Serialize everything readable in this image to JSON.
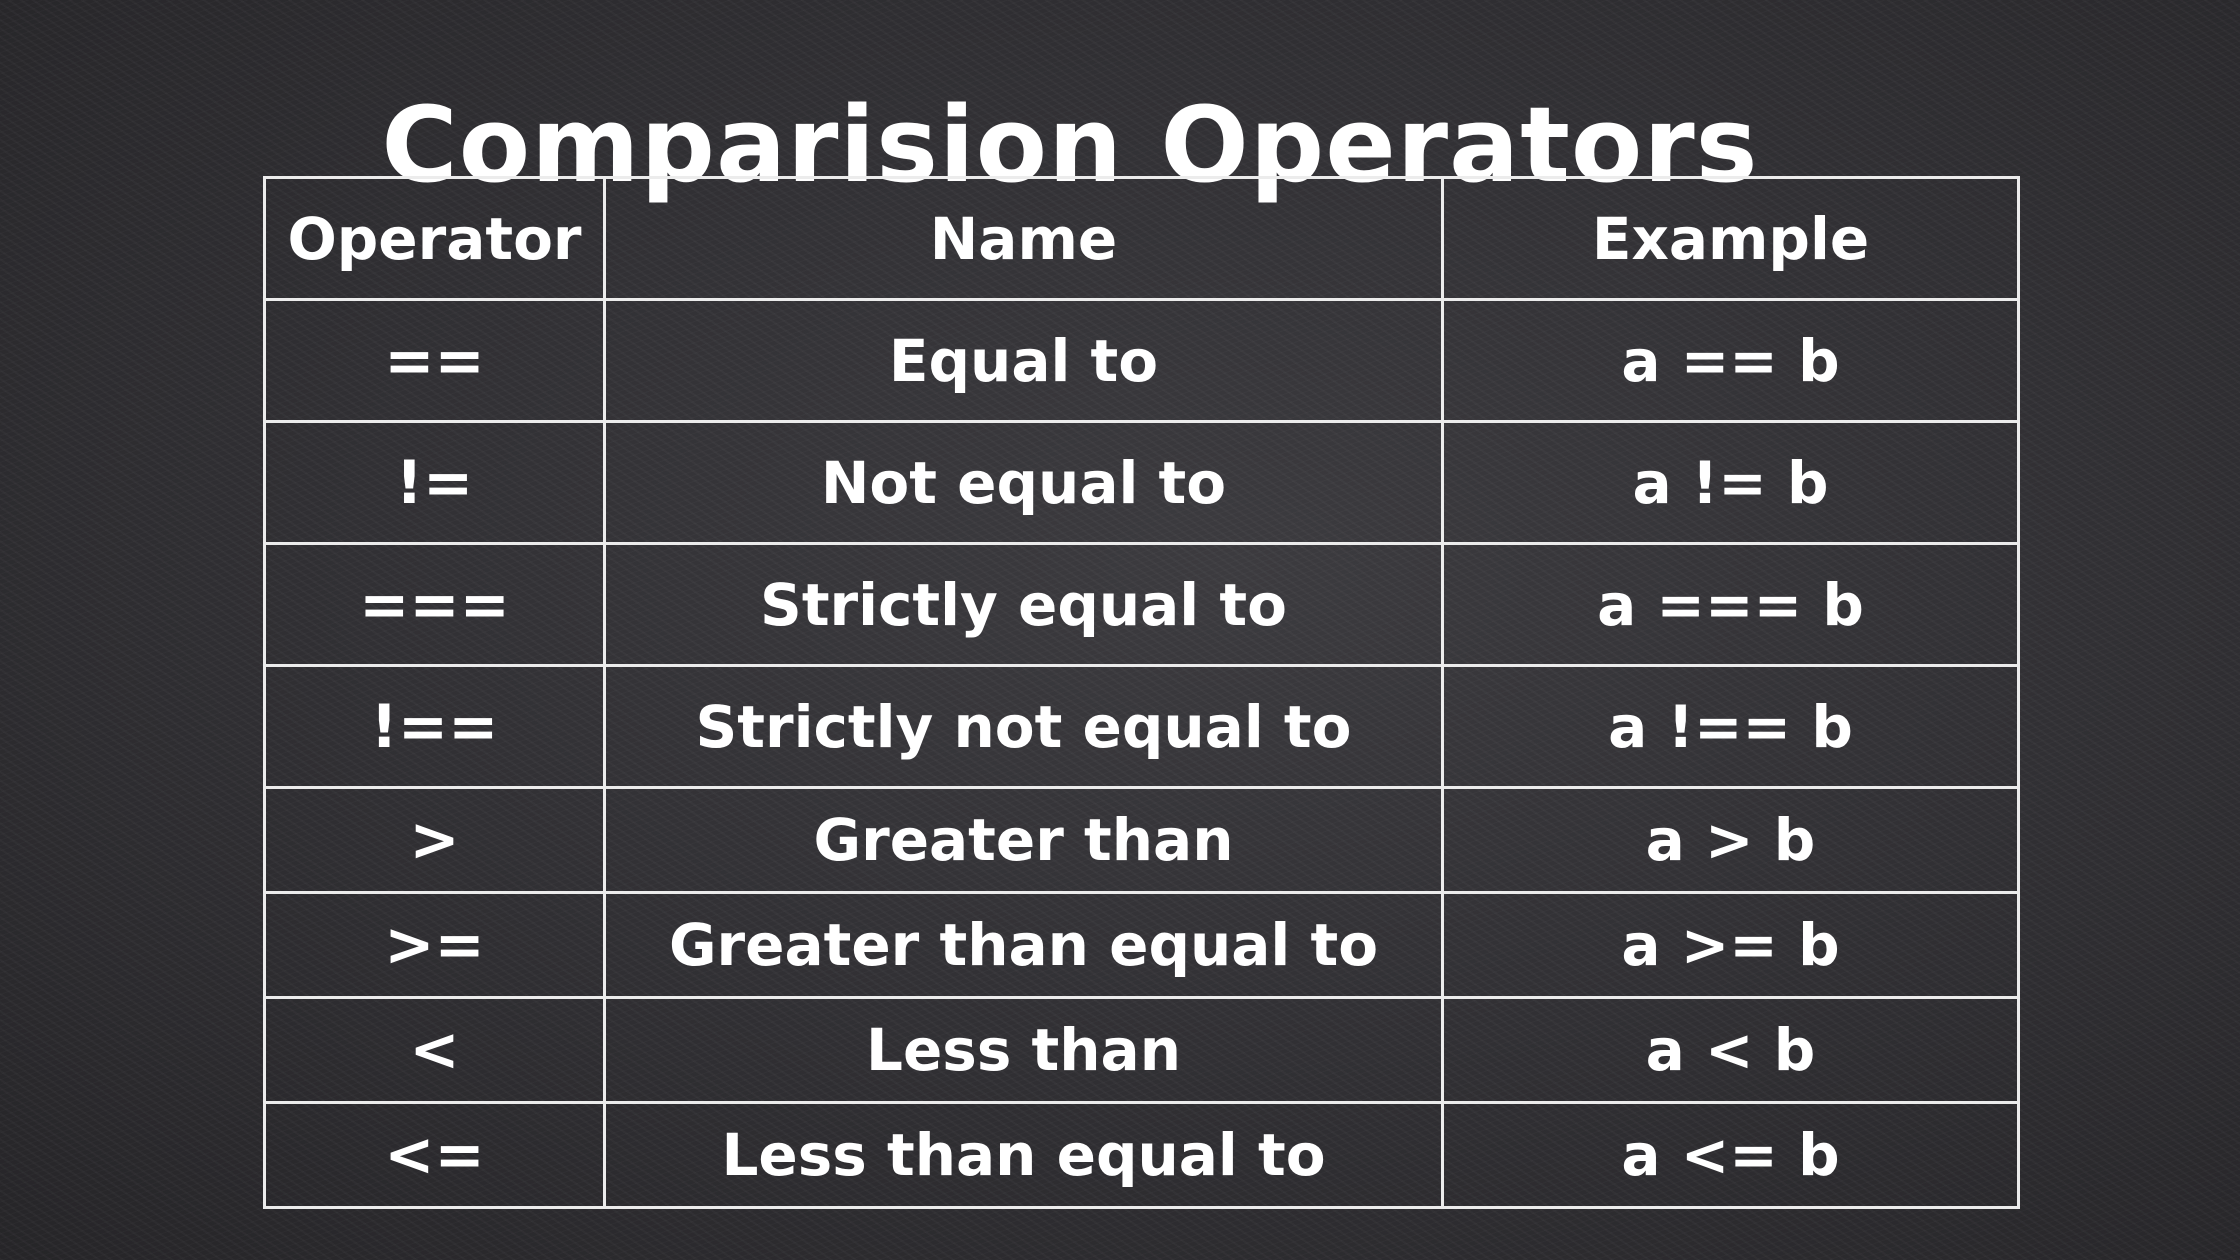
{
  "title": "Comparision Operators",
  "table": {
    "headers": [
      "Operator",
      "Name",
      "Example"
    ],
    "rows": [
      {
        "operator": "==",
        "name": "Equal to",
        "example": "a == b"
      },
      {
        "operator": "!=",
        "name": "Not equal to",
        "example": "a != b"
      },
      {
        "operator": "===",
        "name": "Strictly equal to",
        "example": "a === b"
      },
      {
        "operator": "!==",
        "name": "Strictly not equal to",
        "example": "a !== b"
      },
      {
        "operator": ">",
        "name": "Greater than",
        "example": "a > b"
      },
      {
        "operator": ">=",
        "name": "Greater than equal to",
        "example": "a >= b"
      },
      {
        "operator": "<",
        "name": "Less than",
        "example": "a < b"
      },
      {
        "operator": "<=",
        "name": "Less than equal to",
        "example": "a <= b"
      }
    ]
  },
  "colors": {
    "background": "#323135",
    "text": "#ffffff",
    "border": "#ececec"
  }
}
